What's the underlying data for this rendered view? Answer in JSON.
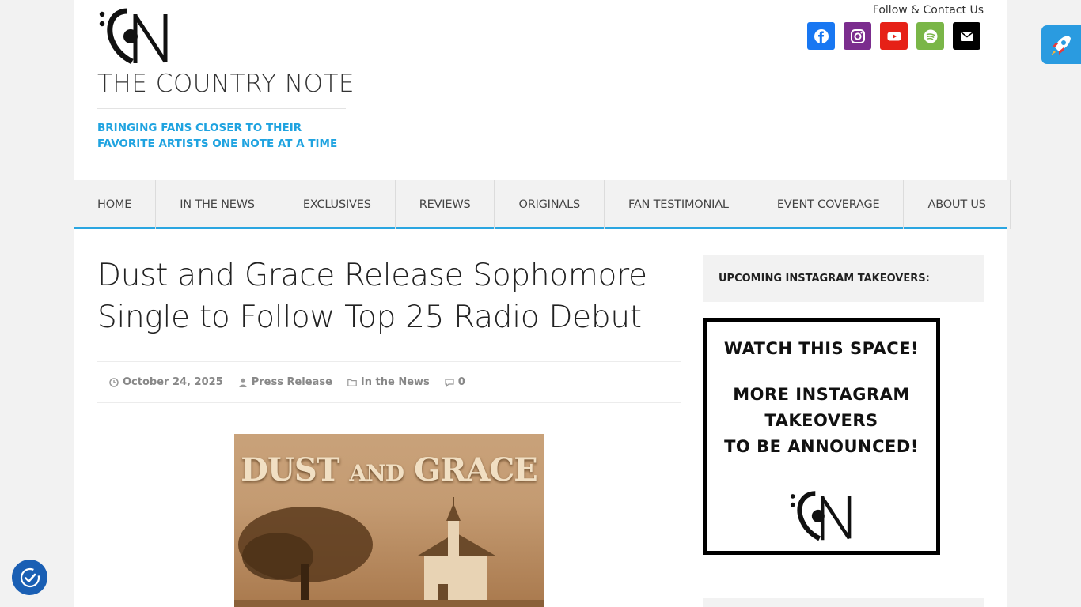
{
  "header": {
    "site_title": "THE COUNTRY NOTE",
    "tagline": "BRINGING FANS CLOSER TO THEIR FAVORITE ARTISTS ONE NOTE AT A TIME",
    "follow_label": "Follow & Contact Us",
    "socials": [
      {
        "icon": "facebook-icon",
        "color": "#1877f2"
      },
      {
        "icon": "instagram-icon",
        "color": "#7b2d8e"
      },
      {
        "icon": "youtube-icon",
        "color": "#e62117"
      },
      {
        "icon": "spotify-icon",
        "color": "#7ab648"
      },
      {
        "icon": "email-icon",
        "color": "#000000"
      }
    ]
  },
  "nav": {
    "items": [
      "HOME",
      "IN THE NEWS",
      "EXCLUSIVES",
      "REVIEWS",
      "ORIGINALS",
      "FAN TESTIMONIAL",
      "EVENT COVERAGE",
      "ABOUT US"
    ],
    "accent": "#2ba6e1"
  },
  "post": {
    "title": "Dust and Grace Release Sophomore Single to Follow Top 25 Radio Debut",
    "date": "October 24, 2025",
    "author": "Press Release",
    "category": "In the News",
    "comments": "0",
    "cover": {
      "title_main": "DUST",
      "title_and": "AND",
      "title_end": "GRACE"
    }
  },
  "sidebar": {
    "widget_title": "UPCOMING INSTAGRAM TAKEOVERS:",
    "promo_line1": "WATCH THIS SPACE!",
    "promo_line2": "MORE INSTAGRAM",
    "promo_line3": "TAKEOVERS",
    "promo_line4": "TO BE ANNOUNCED!"
  }
}
